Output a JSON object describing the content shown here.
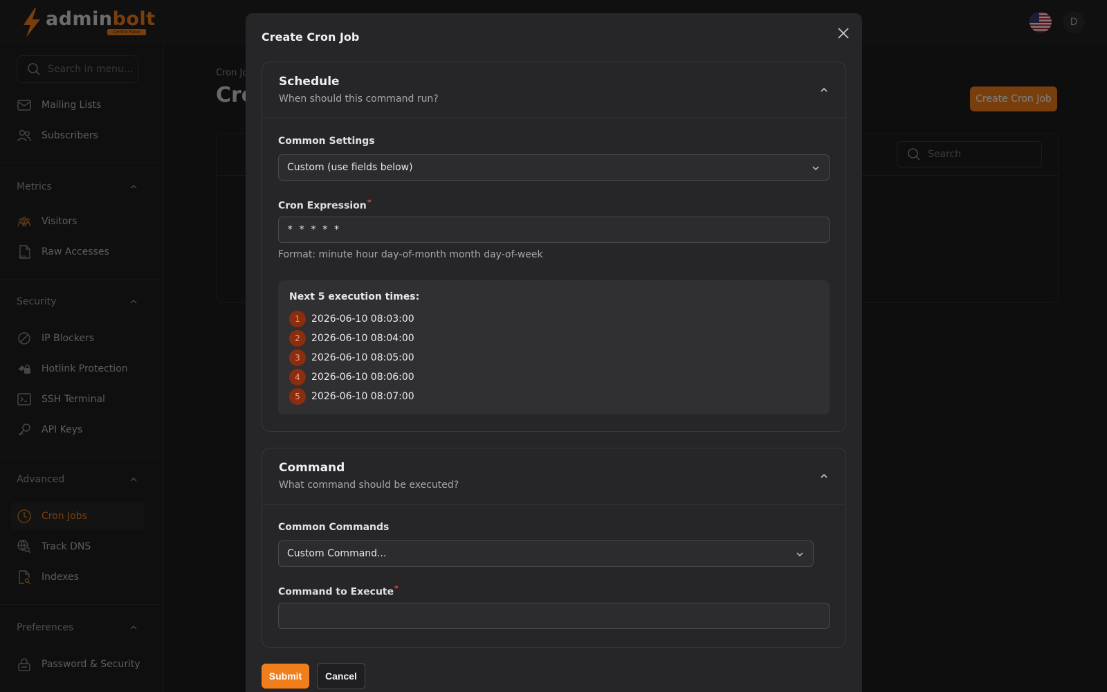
{
  "app": {
    "logo_main": "admin",
    "logo_accent": "bolt",
    "logo_badge": "Control Panel",
    "avatar_initial": "D"
  },
  "sidebar": {
    "search_placeholder": "Search in menu...",
    "items_top": [
      {
        "label": "Mailing Lists",
        "icon": "mail-icon"
      },
      {
        "label": "Subscribers",
        "icon": "users-icon"
      }
    ],
    "sections": [
      {
        "title": "Metrics",
        "items": [
          {
            "label": "Visitors",
            "icon": "visitors-icon"
          },
          {
            "label": "Raw Accesses",
            "icon": "raw-file-icon"
          }
        ]
      },
      {
        "title": "Security",
        "items": [
          {
            "label": "IP Blockers",
            "icon": "block-icon"
          },
          {
            "label": "Hotlink Protection",
            "icon": "hotlink-icon"
          },
          {
            "label": "SSH Terminal",
            "icon": "terminal-icon"
          },
          {
            "label": "API Keys",
            "icon": "key-icon"
          }
        ]
      },
      {
        "title": "Advanced",
        "items": [
          {
            "label": "Cron Jobs",
            "icon": "clock-icon",
            "active": true
          },
          {
            "label": "Track DNS",
            "icon": "dns-icon"
          },
          {
            "label": "Indexes",
            "icon": "file-search-icon"
          }
        ]
      },
      {
        "title": "Preferences",
        "items": [
          {
            "label": "Password & Security",
            "icon": "lock-icon"
          }
        ]
      }
    ]
  },
  "background": {
    "breadcrumb": "Cron Jo",
    "page_title": "Cro",
    "create_button": "Create Cron Job",
    "search_placeholder": "Search"
  },
  "modal": {
    "title": "Create Cron Job",
    "schedule": {
      "title": "Schedule",
      "subtitle": "When should this command run?",
      "common_label": "Common Settings",
      "common_value": "Custom (use fields below)",
      "cron_label": "Cron Expression",
      "cron_value": "* * * * *",
      "format_help": "Format: minute hour day-of-month month day-of-week",
      "next_title": "Next 5 execution times:",
      "next_times": [
        {
          "n": "1",
          "t": "2026-06-10 08:03:00"
        },
        {
          "n": "2",
          "t": "2026-06-10 08:04:00"
        },
        {
          "n": "3",
          "t": "2026-06-10 08:05:00"
        },
        {
          "n": "4",
          "t": "2026-06-10 08:06:00"
        },
        {
          "n": "5",
          "t": "2026-06-10 08:07:00"
        }
      ]
    },
    "command": {
      "title": "Command",
      "subtitle": "What command should be executed?",
      "common_label": "Common Commands",
      "common_value": "Custom Command...",
      "exec_label": "Command to Execute",
      "exec_value": ""
    },
    "submit_label": "Submit",
    "cancel_label": "Cancel"
  },
  "colors": {
    "accent": "#f07e1b",
    "required": "#e5484d"
  }
}
